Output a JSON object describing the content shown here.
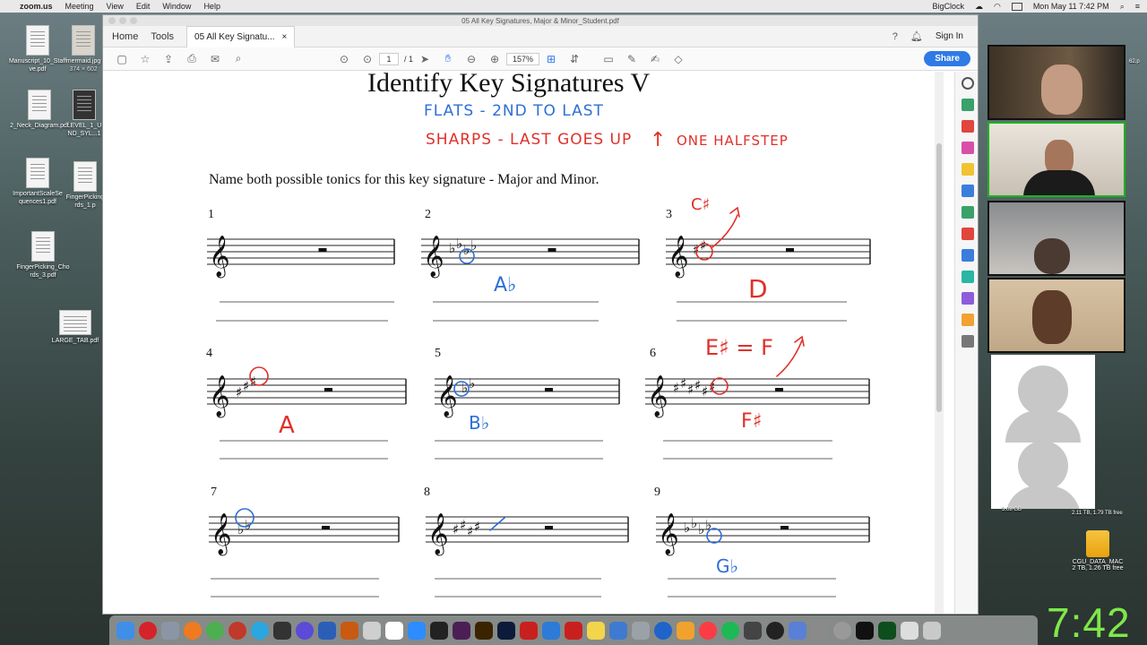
{
  "menubar": {
    "app": "zoom.us",
    "items": [
      "Meeting",
      "View",
      "Edit",
      "Window",
      "Help"
    ],
    "right_app": "BigClock",
    "datetime": "Mon May 11  7:42 PM"
  },
  "desktop_icons": [
    {
      "label": "Manuscript_10_Staff ve.pdf"
    },
    {
      "label": "mermaid.jpg",
      "sub": "374 × 602"
    },
    {
      "label": "2_Neck_Diagram.pdf"
    },
    {
      "label": "LEVEL_1_U ND_SYL...1"
    },
    {
      "label": "ImportantScaleSe quences1.pdf"
    },
    {
      "label": "FingerPicking rds_1.p"
    },
    {
      "label": "FingerPicking_Cho rds_3.pdf"
    },
    {
      "label": "LARGE_TAB.pdf"
    }
  ],
  "window": {
    "title": "05 All Key Signatures, Major & Minor_Student.pdf",
    "tabs": {
      "home": "Home",
      "tools": "Tools",
      "doc_tab": "05 All Key Signatu...",
      "close": "×"
    },
    "sign_in": "Sign In",
    "page_current": "1",
    "page_total": "/ 1",
    "zoom_level": "157%",
    "share_label": "Share"
  },
  "document": {
    "title": "Identify Key Signatures V",
    "instructions": "Name both possible tonics for this key signature - Major and Minor.",
    "exercises": [
      "1",
      "2",
      "3",
      "4",
      "5",
      "6",
      "7",
      "8",
      "9"
    ]
  },
  "annotations": {
    "flats_note": "FLATS - 2ND TO LAST",
    "sharps_note": "SHARPS - LAST GOES UP",
    "halfstep_note": "ONE HALFSTEP",
    "ex2_answer": "A♭",
    "ex3_above": "C♯",
    "ex3_answer": "D",
    "ex4_answer": "A",
    "ex5_answer": "B♭",
    "ex6_above": "E♯ = F",
    "ex6_answer": "F♯",
    "ex9_answer": "G♭"
  },
  "desktop_right": {
    "drive_label": "CGU_DATA_MAC",
    "drive_sub": "2 TB, 1.26 TB free",
    "other_drive": "2.11 TB, 1.79 TB free",
    "small_txt": "3.08 GB",
    "side_label": "62.p"
  },
  "clock": "7:42",
  "colors": {
    "annot_blue": "#2d6fd6",
    "annot_red": "#e0302a",
    "zoom_active": "#1db31d",
    "clock": "#7ee84a",
    "share": "#2f7ae5"
  }
}
